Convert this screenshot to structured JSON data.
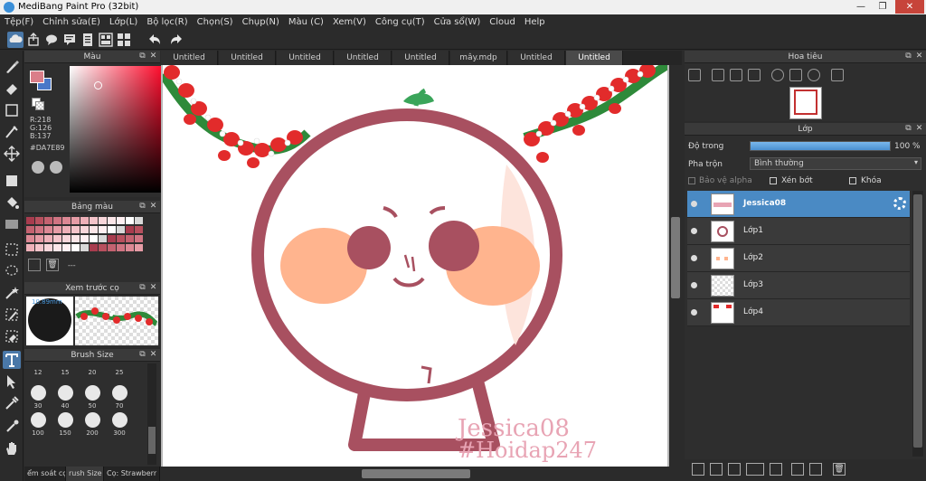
{
  "window": {
    "title": "MediBang Paint Pro (32bit)"
  },
  "menu": [
    "Tệp(F)",
    "Chỉnh sửa(E)",
    "Lớp(L)",
    "Bộ lọc(R)",
    "Chọn(S)",
    "Chụp(N)",
    "Màu (C)",
    "Xem(V)",
    "Công cụ(T)",
    "Cửa sổ(W)",
    "Cloud",
    "Help"
  ],
  "color_panel": {
    "title": "Màu",
    "r": "R:218",
    "g": "G:126",
    "b": "B:137",
    "hex": "#DA7E89",
    "fg_color": "#DA7E89",
    "bg_color": "#4a78c8"
  },
  "palette_panel": {
    "title": "Bảng màu",
    "entry": "---"
  },
  "preview_panel": {
    "title": "Xem trước cọ",
    "size": "10.89mm"
  },
  "brush_panel": {
    "title": "Brush Size",
    "sizes": [
      "12",
      "15",
      "20",
      "25",
      "30",
      "40",
      "50",
      "70",
      "100",
      "150",
      "200",
      "300"
    ]
  },
  "left_tabs": [
    "ểm soát cọ",
    "rush Size",
    "Cọ: Strawberr"
  ],
  "doc_tabs": [
    "Untitled",
    "Untitled",
    "Untitled",
    "Untitled",
    "Untitled",
    "mây.mdp",
    "Untitled",
    "Untitled"
  ],
  "canvas": {
    "watermark_line1": "Jessica08",
    "watermark_line2": "#Hoidap247"
  },
  "nav_panel": {
    "title": "Hoa tiêu"
  },
  "layer_panel": {
    "title": "Lớp",
    "opacity_label": "Độ trong",
    "opacity_value": "100 %",
    "opacity": 1.0,
    "blend_label": "Pha trộn",
    "blend_value": "Bình thường",
    "protect_alpha": "Bảo vệ alpha",
    "clipping": "Xén bớt",
    "lock": "Khóa",
    "layers": [
      "Jessica08",
      "Lớp1",
      "Lớp2",
      "Lớp3",
      "Lớp4"
    ]
  }
}
